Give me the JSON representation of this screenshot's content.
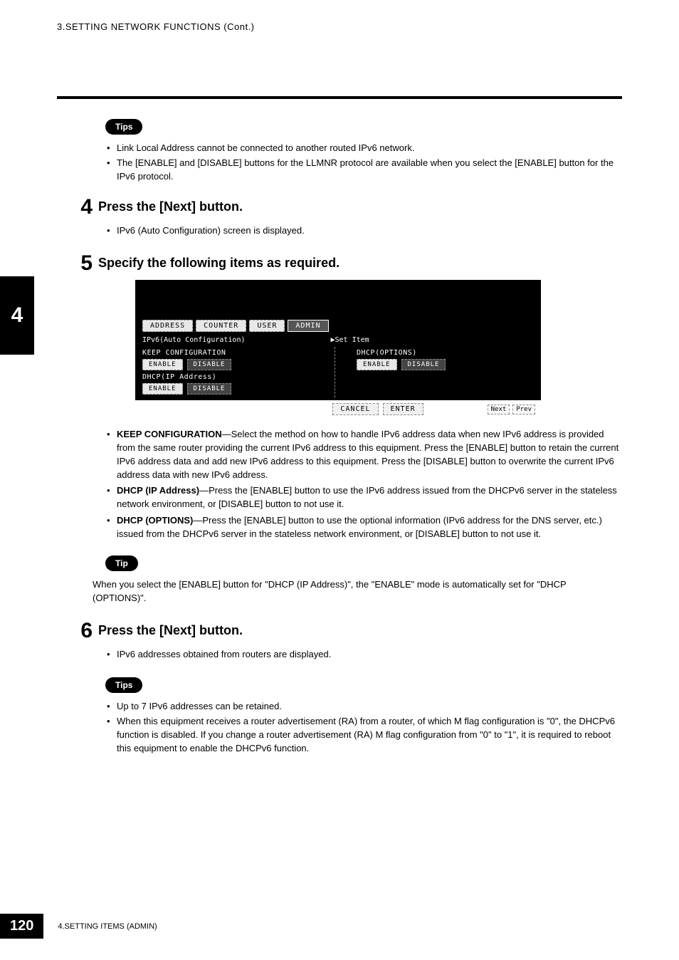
{
  "header": {
    "title": "3.SETTING NETWORK FUNCTIONS (Cont.)"
  },
  "sideTab": "4",
  "tipsBadge": "Tips",
  "tipBadge": "Tip",
  "topTips": [
    "Link Local Address cannot be connected to another routed IPv6 network.",
    "The [ENABLE] and [DISABLE] buttons for the LLMNR protocol are available when you select the [ENABLE] button for the IPv6 protocol."
  ],
  "step4": {
    "num": "4",
    "heading": "Press the [Next] button.",
    "bullet": "IPv6 (Auto Configuration) screen is displayed."
  },
  "step5": {
    "num": "5",
    "heading": "Specify the following items as required."
  },
  "screenshot": {
    "tabs": {
      "address": "ADDRESS",
      "counter": "COUNTER",
      "user": "USER",
      "admin": "ADMIN"
    },
    "title": "IPv6(Auto Configuration)",
    "setItem": "▶Set Item",
    "keepConfig": "KEEP CONFIGURATION",
    "dhcpOptions": "DHCP(OPTIONS)",
    "dhcpIp": "DHCP(IP Address)",
    "enable": "ENABLE",
    "disable": "DISABLE",
    "cancel": "CANCEL",
    "enter": "ENTER",
    "next": "Next",
    "prev": "Prev"
  },
  "definitions": [
    {
      "term": "KEEP CONFIGURATION",
      "text": "—Select the method on how to handle IPv6 address data when new IPv6 address is provided from the same router providing the current IPv6 address to this equipment. Press the [ENABLE] button to retain the current IPv6 address data and add new IPv6 address to this equipment. Press the [DISABLE] button to overwrite the current IPv6 address data with new IPv6 address."
    },
    {
      "term": "DHCP (IP Address)",
      "text": "—Press the [ENABLE] button to use the IPv6 address issued from the DHCPv6 server in the stateless network environment, or [DISABLE] button to not use it."
    },
    {
      "term": "DHCP (OPTIONS)",
      "text": "—Press the [ENABLE] button to use the optional information (IPv6 address for the DNS server, etc.) issued from the DHCPv6 server in the stateless network environment, or [DISABLE] button to not use it."
    }
  ],
  "tipText": "When you select the [ENABLE] button for \"DHCP (IP Address)\", the \"ENABLE\" mode is automatically set for \"DHCP (OPTIONS)\".",
  "step6": {
    "num": "6",
    "heading": "Press the [Next] button.",
    "bullet": "IPv6 addresses obtained from routers are displayed."
  },
  "bottomTips": [
    "Up to 7 IPv6 addresses can be retained.",
    "When this equipment receives a router advertisement (RA) from a router, of which M flag configuration is \"0\", the DHCPv6 function is disabled. If you change a router advertisement (RA) M flag configuration from \"0\" to \"1\", it is required to reboot this equipment to enable the DHCPv6 function."
  ],
  "footer": {
    "pageNum": "120",
    "text": "4.SETTING ITEMS (ADMIN)"
  }
}
